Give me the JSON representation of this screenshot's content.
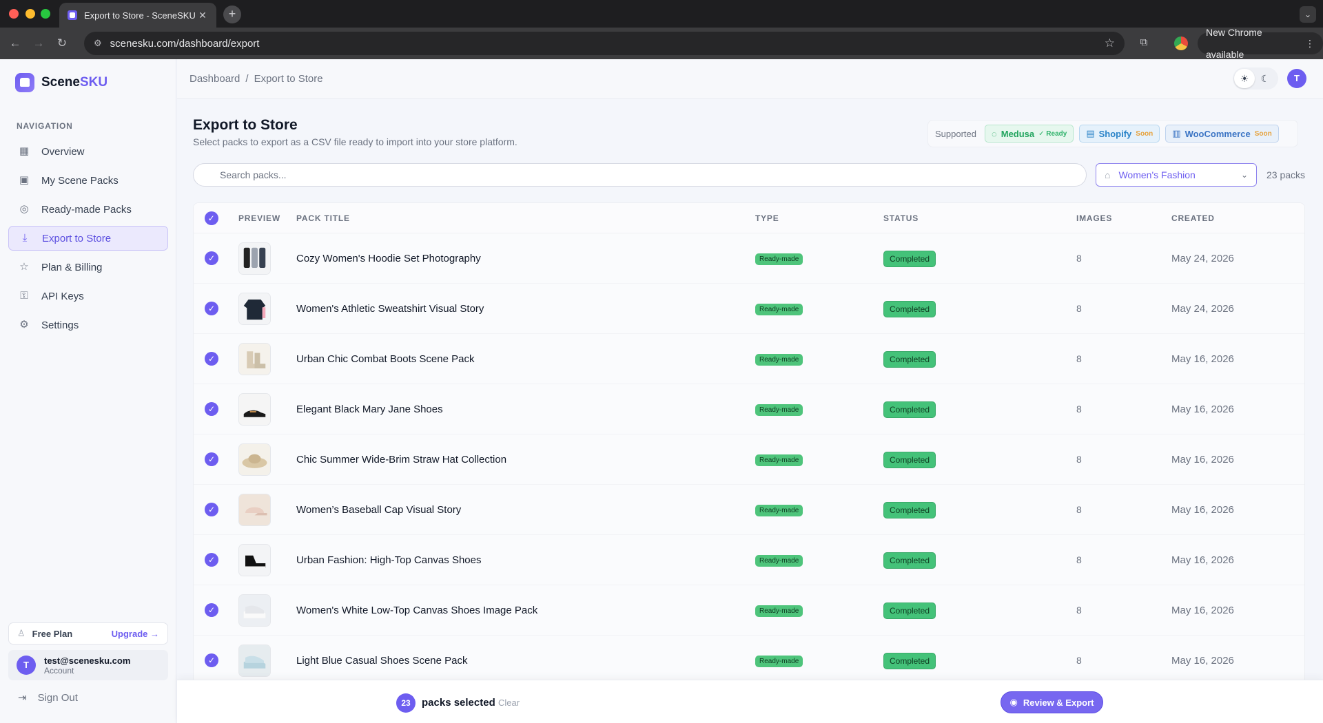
{
  "browser": {
    "tab_title": "Export to Store - SceneSKU",
    "url": "scenesku.com/dashboard/export",
    "new_chrome": "New Chrome available"
  },
  "brand": {
    "name_a": "Scene",
    "name_b": "SKU"
  },
  "sidebar": {
    "heading": "NAVIGATION",
    "items": [
      {
        "label": "Overview",
        "icon": "grid-icon",
        "active": false
      },
      {
        "label": "My Scene Packs",
        "icon": "image-icon",
        "active": false
      },
      {
        "label": "Ready-made Packs",
        "icon": "globe-icon",
        "active": false
      },
      {
        "label": "Export to Store",
        "icon": "download-icon",
        "active": true
      },
      {
        "label": "Plan & Billing",
        "icon": "star-icon",
        "active": false
      },
      {
        "label": "API Keys",
        "icon": "key-icon",
        "active": false
      },
      {
        "label": "Settings",
        "icon": "gear-icon",
        "active": false
      }
    ],
    "plan": "Free Plan",
    "upgrade": "Upgrade →",
    "account_initial": "T",
    "account_email": "test@scenesku.com",
    "account_label": "Account",
    "signout": "Sign Out"
  },
  "header": {
    "breadcrumb_root": "Dashboard",
    "breadcrumb_sep": "/",
    "breadcrumb_current": "Export to Store",
    "user_initial": "T"
  },
  "main": {
    "title": "Export to Store",
    "subtitle": "Select packs to export as a CSV file ready to import into your store platform.",
    "supported_label": "Supported",
    "platforms": [
      {
        "name": "Medusa",
        "tag": "✓ Ready"
      },
      {
        "name": "Shopify",
        "tag": "Soon"
      },
      {
        "name": "WooCommerce",
        "tag": "Soon"
      }
    ],
    "search_placeholder": "Search packs...",
    "filter_value": "Women's Fashion",
    "pack_count": "23 packs"
  },
  "table": {
    "headers": [
      "PREVIEW",
      "PACK TITLE",
      "TYPE",
      "STATUS",
      "IMAGES",
      "CREATED"
    ],
    "rows": [
      {
        "title": "Cozy Women's Hoodie Set Photography",
        "type": "Ready-made",
        "status": "Completed",
        "images": "8",
        "created": "May 24, 2026",
        "thumb": "hoodie-set"
      },
      {
        "title": "Women's Athletic Sweatshirt Visual Story",
        "type": "Ready-made",
        "status": "Completed",
        "images": "8",
        "created": "May 24, 2026",
        "thumb": "sweatshirt"
      },
      {
        "title": "Urban Chic Combat Boots Scene Pack",
        "type": "Ready-made",
        "status": "Completed",
        "images": "8",
        "created": "May 16, 2026",
        "thumb": "boots"
      },
      {
        "title": "Elegant Black Mary Jane Shoes",
        "type": "Ready-made",
        "status": "Completed",
        "images": "8",
        "created": "May 16, 2026",
        "thumb": "mary-jane"
      },
      {
        "title": "Chic Summer Wide-Brim Straw Hat Collection",
        "type": "Ready-made",
        "status": "Completed",
        "images": "8",
        "created": "May 16, 2026",
        "thumb": "straw-hat"
      },
      {
        "title": "Women’s Baseball Cap Visual Story",
        "type": "Ready-made",
        "status": "Completed",
        "images": "8",
        "created": "May 16, 2026",
        "thumb": "cap"
      },
      {
        "title": "Urban Fashion: High-Top Canvas Shoes",
        "type": "Ready-made",
        "status": "Completed",
        "images": "8",
        "created": "May 16, 2026",
        "thumb": "high-top"
      },
      {
        "title": "Women's White Low-Top Canvas Shoes Image Pack",
        "type": "Ready-made",
        "status": "Completed",
        "images": "8",
        "created": "May 16, 2026",
        "thumb": "low-top"
      },
      {
        "title": "Light Blue Casual Shoes Scene Pack",
        "type": "Ready-made",
        "status": "Completed",
        "images": "8",
        "created": "May 16, 2026",
        "thumb": "blue-shoes"
      }
    ]
  },
  "footer": {
    "selected_count": "23",
    "selected_label": "packs selected",
    "clear": "Clear",
    "review_export": "Review & Export"
  },
  "colors": {
    "accent": "#6d5df0",
    "status_green": "#44c279"
  }
}
